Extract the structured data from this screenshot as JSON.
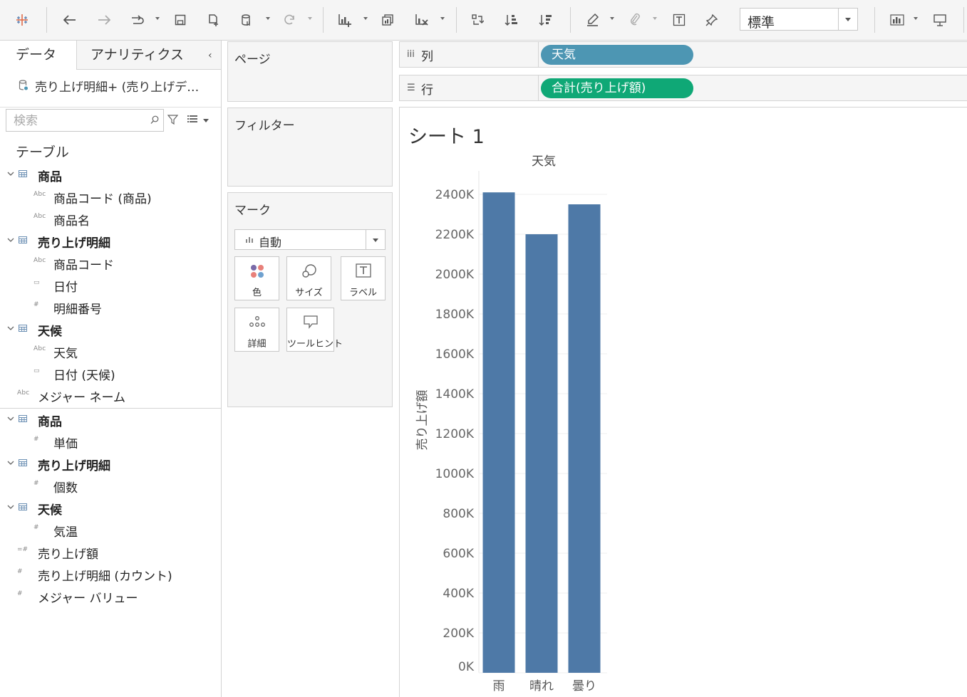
{
  "toolbar": {
    "fit_select": "標準"
  },
  "data_pane": {
    "tab_data": "データ",
    "tab_analytics": "アナリティクス",
    "datasource": "売り上げ明細+ (売り上げデ…",
    "search_placeholder": "検索",
    "tables_heading": "テーブル",
    "dimensions": [
      {
        "kind": "group",
        "label": "商品"
      },
      {
        "kind": "field",
        "type": "abc",
        "label": "商品コード (商品)"
      },
      {
        "kind": "field",
        "type": "abc",
        "label": "商品名"
      },
      {
        "kind": "group",
        "label": "売り上げ明細"
      },
      {
        "kind": "field",
        "type": "abc",
        "label": "商品コード"
      },
      {
        "kind": "field",
        "type": "date",
        "label": "日付"
      },
      {
        "kind": "field",
        "type": "number",
        "label": "明細番号"
      },
      {
        "kind": "group",
        "label": "天候"
      },
      {
        "kind": "field",
        "type": "abc",
        "label": "天気"
      },
      {
        "kind": "field",
        "type": "date",
        "label": "日付 (天候)"
      },
      {
        "kind": "top",
        "type": "abc",
        "label": "メジャー ネーム"
      }
    ],
    "measures": [
      {
        "kind": "group",
        "label": "商品"
      },
      {
        "kind": "field",
        "type": "number",
        "label": "単価"
      },
      {
        "kind": "group",
        "label": "売り上げ明細"
      },
      {
        "kind": "field",
        "type": "number",
        "label": "個数"
      },
      {
        "kind": "group",
        "label": "天候"
      },
      {
        "kind": "field",
        "type": "number",
        "label": "気温"
      },
      {
        "kind": "top",
        "type": "calc",
        "label": "売り上げ額"
      },
      {
        "kind": "top",
        "type": "number",
        "label": "売り上げ明細 (カウント)"
      },
      {
        "kind": "top",
        "type": "number",
        "label": "メジャー バリュー"
      }
    ]
  },
  "cards": {
    "pages": "ページ",
    "filters": "フィルター",
    "marks": "マーク",
    "marks_type": "自動",
    "mark_buttons": [
      "色",
      "サイズ",
      "ラベル",
      "詳細",
      "ツールヒント"
    ]
  },
  "shelves": {
    "columns_label": "列",
    "columns_pill": "天気",
    "columns_pill_color": "#4d96b3",
    "rows_label": "行",
    "rows_pill": "合計(売り上げ額)",
    "rows_pill_color": "#0fa876"
  },
  "sheet_title": "シート 1",
  "chart_data": {
    "type": "bar",
    "header": "天気",
    "categories": [
      "雨",
      "晴れ",
      "曇り"
    ],
    "values": [
      2410000,
      2200000,
      2350000
    ],
    "ylabel": "売り上げ額",
    "ylim": [
      0,
      2400000
    ],
    "yticks": [
      0,
      200000,
      400000,
      600000,
      800000,
      1000000,
      1200000,
      1400000,
      1600000,
      1800000,
      2000000,
      2200000,
      2400000
    ],
    "ytick_labels": [
      "0K",
      "200K",
      "400K",
      "600K",
      "800K",
      "1000K",
      "1200K",
      "1400K",
      "1600K",
      "1800K",
      "2000K",
      "2200K",
      "2400K"
    ],
    "bar_color": "#4e79a7",
    "grid": true
  }
}
